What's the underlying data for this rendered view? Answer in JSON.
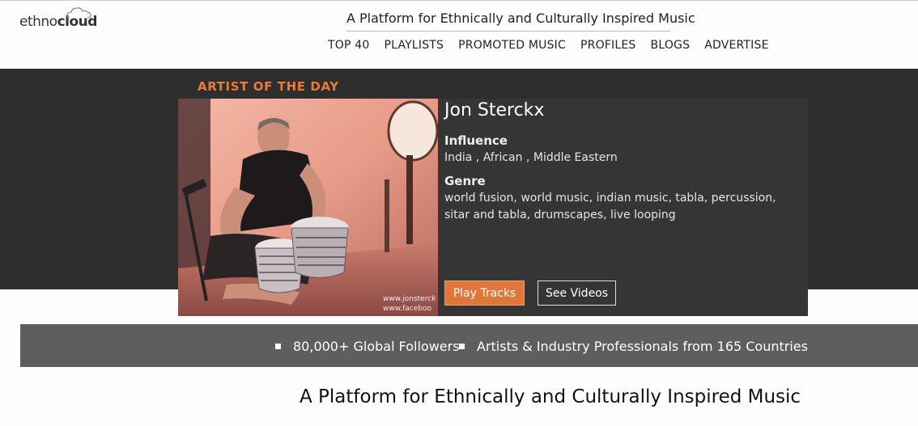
{
  "brand": {
    "logo_text_normal": "ethno",
    "logo_text_bold": "cloud"
  },
  "header": {
    "tagline": "A Platform for Ethnically and Culturally Inspired Music",
    "nav": [
      "TOP 40",
      "PLAYLISTS",
      "PROMOTED MUSIC",
      "PROFILES",
      "BLOGS",
      "ADVERTISE"
    ]
  },
  "feature": {
    "section_label": "ARTIST OF THE DAY",
    "artist_name": "Jon Sterckx",
    "influence_label": "Influence",
    "influence_value": "India , African , Middle Eastern",
    "genre_label": "Genre",
    "genre_value": "world fusion, world music, indian music, tabla, percussion, sitar and tabla, drumscapes, live looping",
    "photo_watermark_1": "www.jonsterck",
    "photo_watermark_2": "www.faceboo",
    "play_button": "Play Tracks",
    "videos_button": "See Videos"
  },
  "stats": {
    "followers": "80,000+ Global Followers",
    "countries": "Artists & Industry Professionals from 165 Countries"
  },
  "bottom": {
    "title": "A Platform for Ethnically and Culturally Inspired Music"
  },
  "colors": {
    "accent": "#e0773a",
    "hero_bg": "#2e2e2e",
    "stats_bg": "#5e5e5e"
  }
}
